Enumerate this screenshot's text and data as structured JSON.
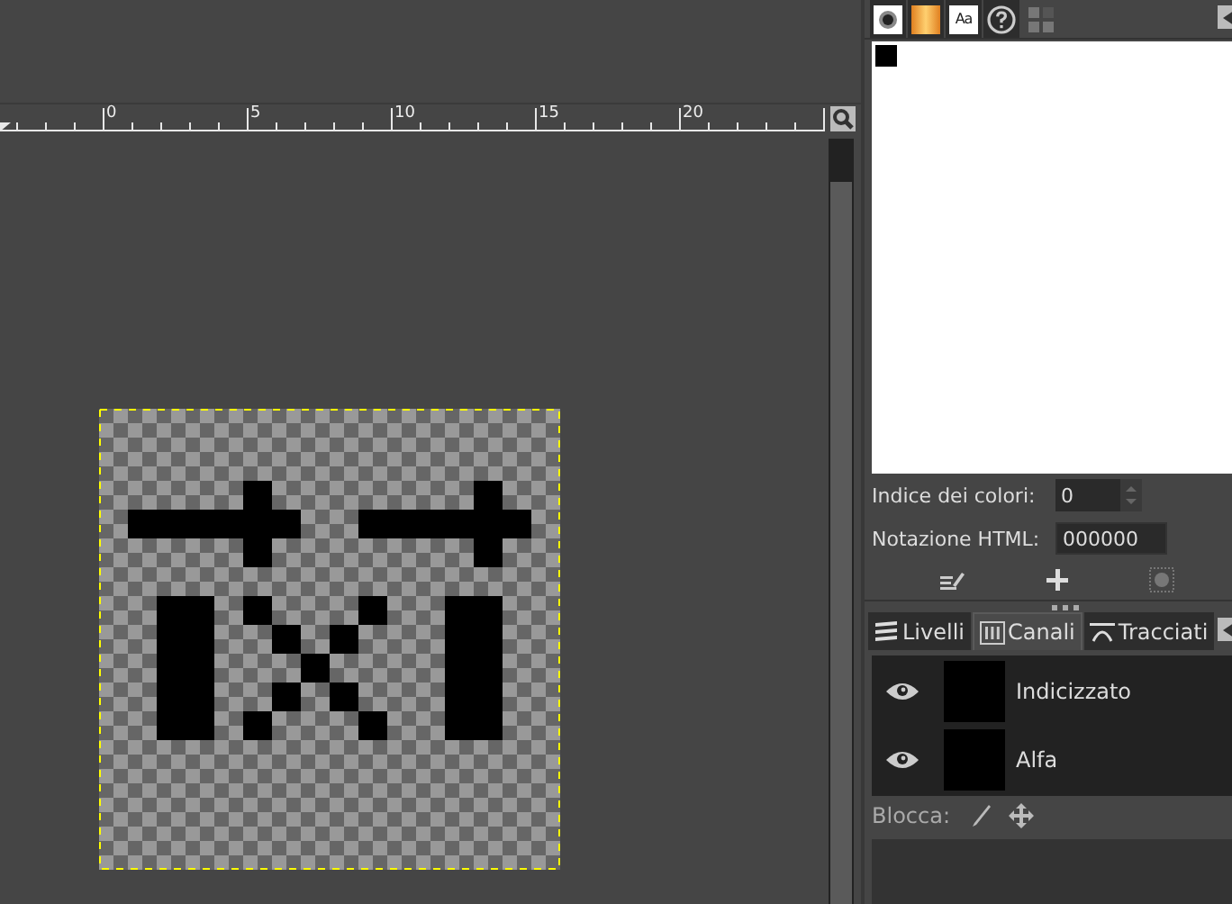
{
  "ruler": {
    "labels": [
      "0",
      "5",
      "10",
      "15",
      "20"
    ]
  },
  "dock_top_tabs": [
    {
      "kind": "brush",
      "selected": false
    },
    {
      "kind": "gradient",
      "selected": false
    },
    {
      "kind": "font",
      "label": "Aa",
      "selected": false
    },
    {
      "kind": "help",
      "selected": false
    },
    {
      "kind": "palette",
      "selected": true
    }
  ],
  "palette": {
    "swatches": [
      {
        "color": "#000000"
      }
    ]
  },
  "color_index": {
    "label": "Indice dei colori:",
    "value": "0"
  },
  "html_notation": {
    "label": "Notazione HTML:",
    "value": "000000"
  },
  "dock_tabs": [
    {
      "kind": "layers",
      "label": "Livelli",
      "selected": false
    },
    {
      "kind": "channels",
      "label": "Canali",
      "selected": true
    },
    {
      "kind": "paths",
      "label": "Tracciati",
      "selected": false
    }
  ],
  "channels": [
    {
      "name": "Indicizzato",
      "visible": true
    },
    {
      "name": "Alfa",
      "visible": true
    }
  ],
  "lock": {
    "label": "Blocca:"
  }
}
